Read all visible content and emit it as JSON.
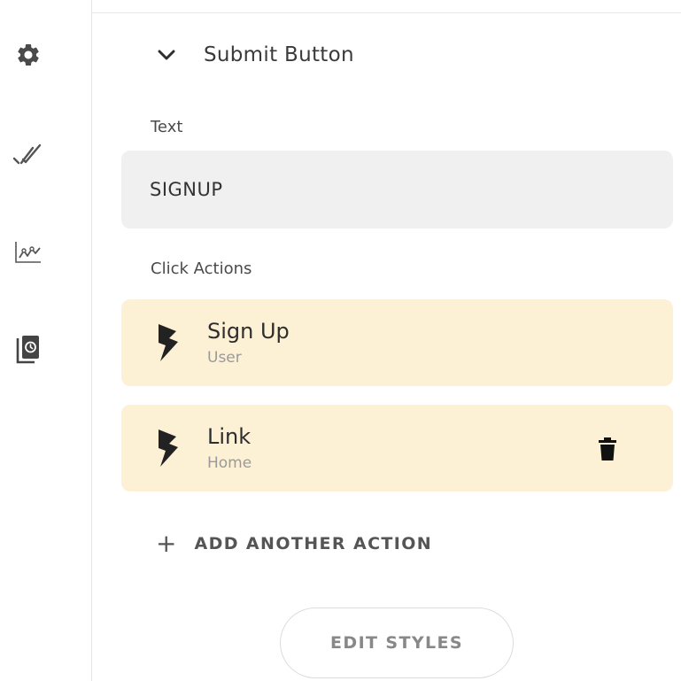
{
  "sidebar": {
    "icons": [
      {
        "name": "settings-gear-icon"
      },
      {
        "name": "double-check-icon"
      },
      {
        "name": "analytics-chart-icon"
      },
      {
        "name": "copy-timer-icon"
      }
    ]
  },
  "section": {
    "title": "Submit Button",
    "chevron_icon": "chevron-down-icon"
  },
  "text_field": {
    "label": "Text",
    "value": "SIGNUP"
  },
  "click_actions": {
    "label": "Click Actions",
    "items": [
      {
        "title": "Sign Up",
        "subtitle": "User",
        "icon": "lightning-bolt-icon"
      },
      {
        "title": "Link",
        "subtitle": "Home",
        "icon": "lightning-bolt-icon",
        "delete_icon": "trash-icon"
      }
    ],
    "add_label": "ADD ANOTHER ACTION",
    "add_icon": "+"
  },
  "footer": {
    "edit_styles_label": "EDIT STYLES"
  },
  "colors": {
    "card_background": "#fdf1d5",
    "input_background": "#f0f0f0",
    "icon_dark": "#333333"
  }
}
